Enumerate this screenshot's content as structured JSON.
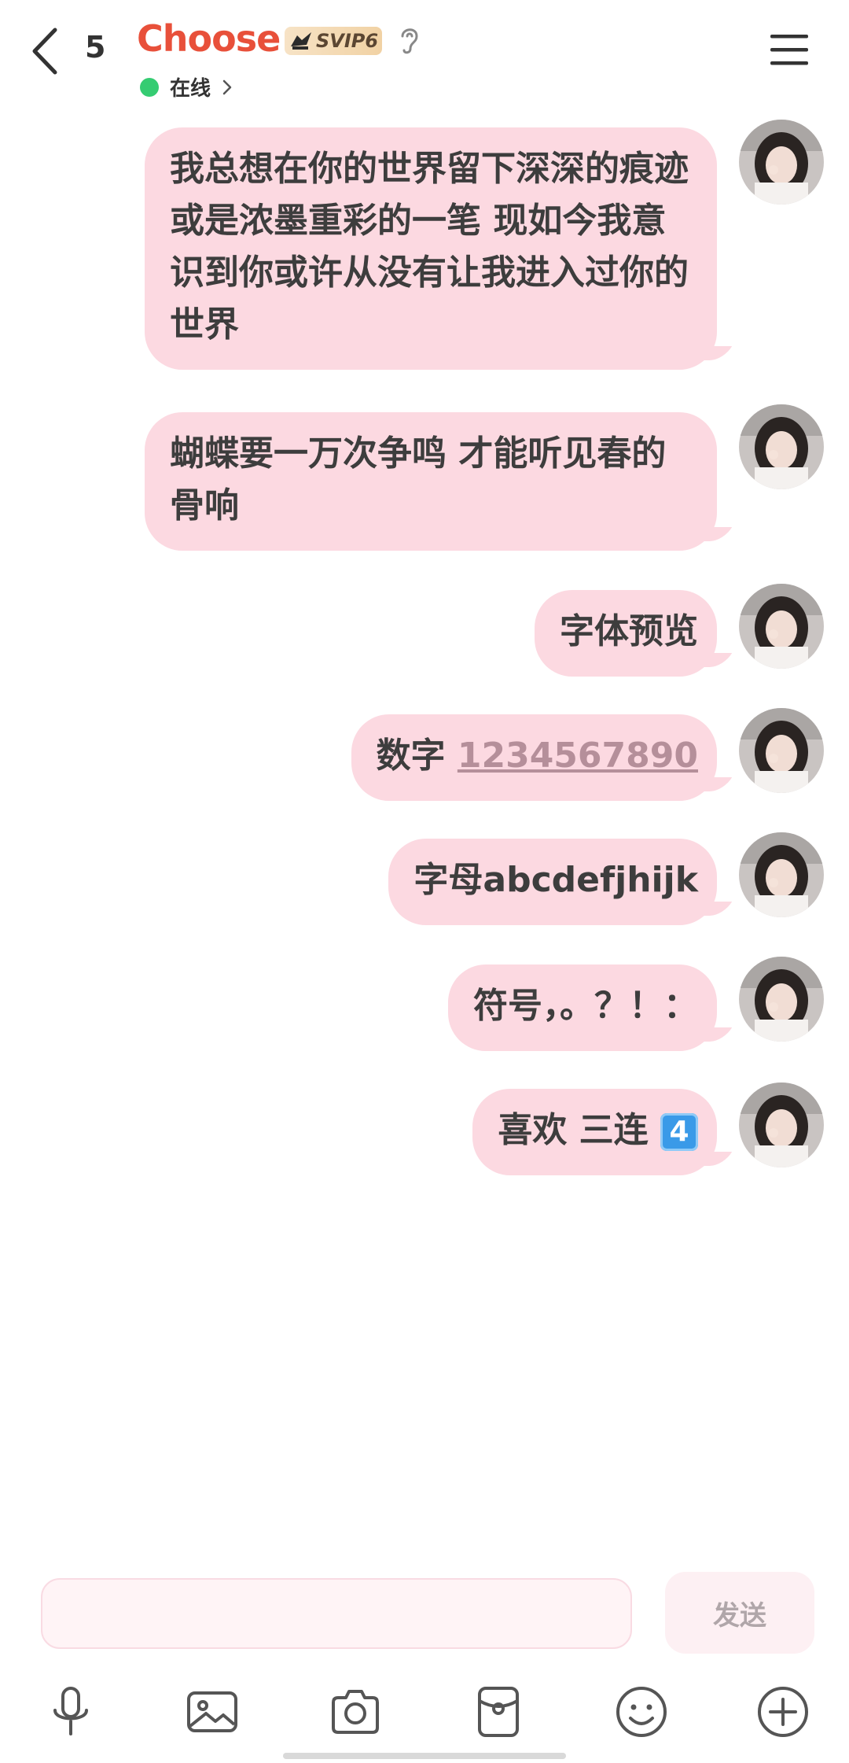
{
  "header": {
    "unread_count": "5",
    "title": "Choose",
    "vip_badge": "SVIP6",
    "status": "在线"
  },
  "messages": [
    {
      "text": "我总想在你的世界留下深深的痕迹 或是浓墨重彩的一笔 现如今我意识到你或许从没有让我进入过你的世界"
    },
    {
      "text": "蝴蝶要一万次争鸣 才能听见春的骨响"
    },
    {
      "text": "字体预览"
    },
    {
      "prefix": "数字 ",
      "link": "1234567890"
    },
    {
      "text": "字母abcdefjhijk"
    },
    {
      "text": "符号，。？！："
    },
    {
      "text": "喜欢 三连 ",
      "emoji": "4"
    }
  ],
  "input": {
    "placeholder": "",
    "send_label": "发送"
  },
  "toolbar": [
    "microphone-icon",
    "image-icon",
    "camera-icon",
    "red-packet-icon",
    "emoji-icon",
    "plus-icon"
  ],
  "colors": {
    "title": "#e8503a",
    "bubble": "#fcd9e1",
    "online": "#35cc72"
  }
}
